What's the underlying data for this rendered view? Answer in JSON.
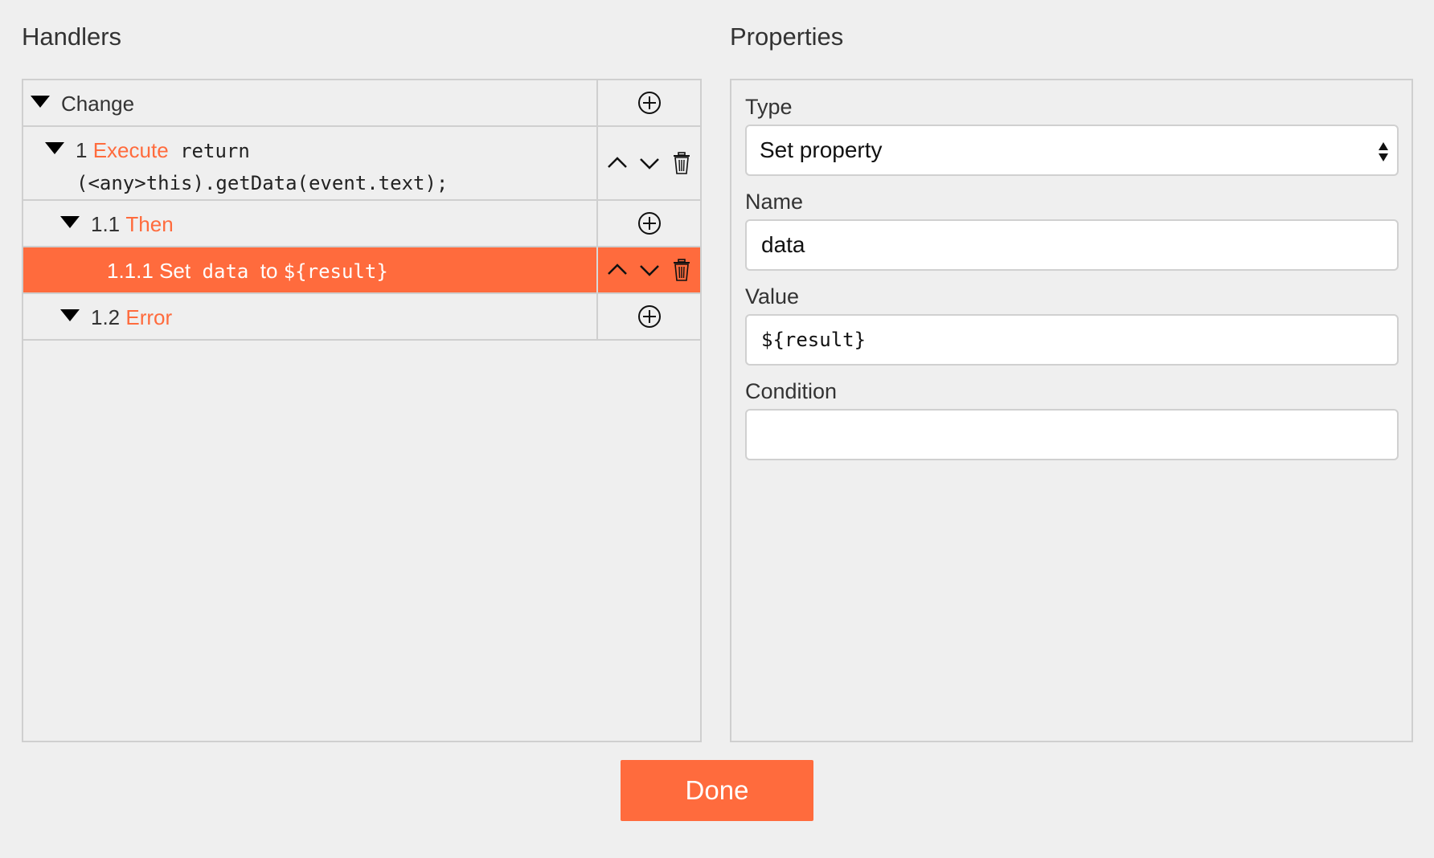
{
  "handlers": {
    "title": "Handlers",
    "rows": [
      {
        "type": "group",
        "label": "Change"
      },
      {
        "type": "action",
        "number": "1",
        "keyword": "Execute",
        "code_line1": "return",
        "code_line2": "(<any>this).getData(event.text);"
      },
      {
        "type": "group",
        "number": "1.1",
        "keyword": "Then"
      },
      {
        "type": "action",
        "number": "1.1.1",
        "keyword": "Set",
        "property": "data",
        "connector": "to",
        "value": "${result}",
        "selected": true
      },
      {
        "type": "group",
        "number": "1.2",
        "keyword": "Error"
      }
    ]
  },
  "properties": {
    "title": "Properties",
    "type_label": "Type",
    "type_value": "Set property",
    "name_label": "Name",
    "name_value": "data",
    "value_label": "Value",
    "value_value": "${result}",
    "condition_label": "Condition",
    "condition_value": ""
  },
  "done_label": "Done",
  "colors": {
    "accent": "#ff6b3d",
    "background": "#efefef",
    "border": "#cfcfcf"
  },
  "icons": [
    "triangle-down-icon",
    "plus-circle-icon",
    "chevron-up-icon",
    "chevron-down-icon",
    "trash-icon",
    "select-arrows-icon"
  ]
}
